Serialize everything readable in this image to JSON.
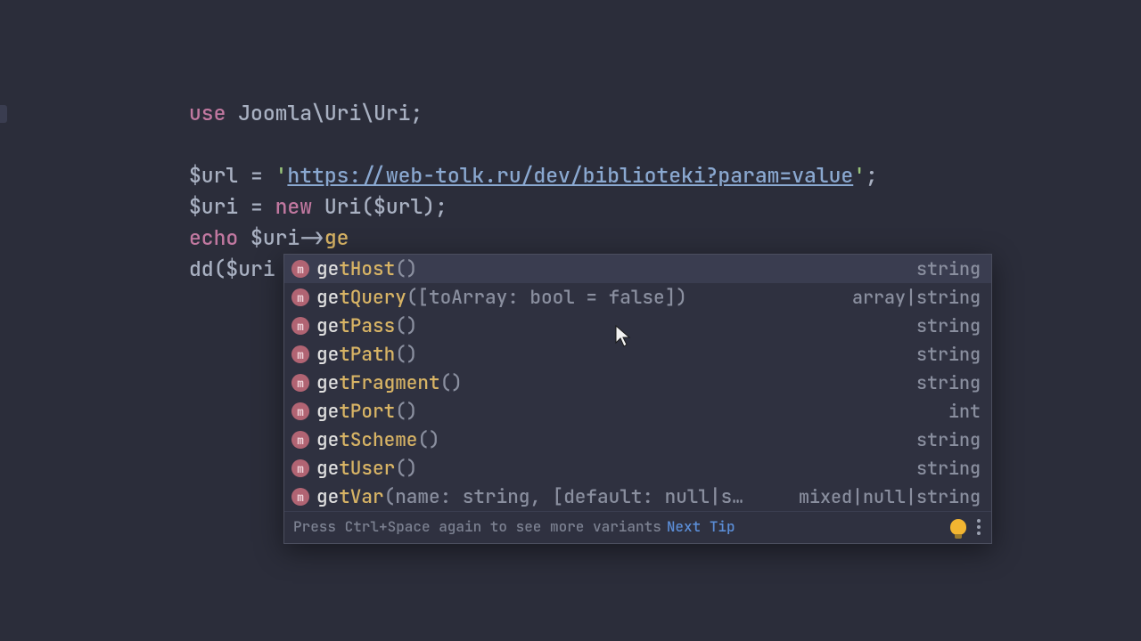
{
  "code": {
    "use_kw": "use",
    "ns1": "Joomla",
    "ns2": "Uri",
    "ns3": "Uri",
    "var_url": "$url",
    "eq": " = ",
    "q1": "'",
    "url_val": "https://web-tolk.ru/dev/biblioteki?param=value",
    "q2": "'",
    "semi": ";",
    "var_uri": "$uri",
    "new_kw": "new",
    "uri_cls": "Uri",
    "open": "(",
    "close": ")",
    "echo_kw": "echo",
    "arrow": "->",
    "partial": "ge",
    "dd_fn": "dd",
    "dd_arg": "$uri"
  },
  "autocomplete": {
    "items": [
      {
        "name": "getHost",
        "params": "()",
        "type": "string"
      },
      {
        "name": "getQuery",
        "params": "([toArray: bool = false])",
        "type": "array|string"
      },
      {
        "name": "getPass",
        "params": "()",
        "type": "string"
      },
      {
        "name": "getPath",
        "params": "()",
        "type": "string"
      },
      {
        "name": "getFragment",
        "params": "()",
        "type": "string"
      },
      {
        "name": "getPort",
        "params": "()",
        "type": "int"
      },
      {
        "name": "getScheme",
        "params": "()",
        "type": "string"
      },
      {
        "name": "getUser",
        "params": "()",
        "type": "string"
      },
      {
        "name": "getVar",
        "params": "(name: string, [default: null|s…",
        "type": "mixed|null|string"
      }
    ],
    "footer_tip": "Press Ctrl+Space again to see more variants",
    "next_tip": "Next Tip",
    "icon_letter": "m"
  }
}
